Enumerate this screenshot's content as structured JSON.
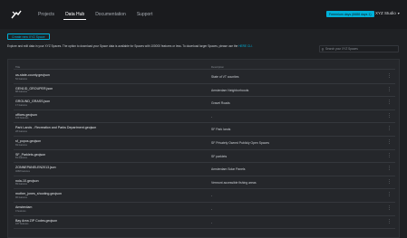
{
  "nav": {
    "items": [
      "Projects",
      "Data Hub",
      "Documentation",
      "Support"
    ],
    "active_index": 1
  },
  "header": {
    "badge": "Freemium days (6688 days 1)",
    "studio_label": "XYZ Studio"
  },
  "toolbar": {
    "create_label": "Create new XYZ Space"
  },
  "description": {
    "text": "Explore and edit data in your XYZ Spaces. The option to download your Space data is available for Spaces with 100000 features or less. To download larger Spaces, please use the ",
    "link": "HERE CLI."
  },
  "search": {
    "placeholder": "Search your XYZ Spaces"
  },
  "table": {
    "columns": [
      "Title",
      "Description"
    ],
    "rows": [
      {
        "name": "us-state-county.geojson",
        "meta": "52 features",
        "description": "State of VT counties"
      },
      {
        "name": "GEN1ID_GROUPER.json",
        "meta": "88 features",
        "description": "Amsterdam Neighborhoods"
      },
      {
        "name": "GROUND_GRASS.json",
        "meta": "17 features",
        "description": "Gravel Roads"
      },
      {
        "name": "offices.geojson",
        "meta": "120 features",
        "description": "-"
      },
      {
        "name": "Park Lands - Recreation and Parks Department.geojson",
        "meta": "28 features",
        "description": "SF Park lands"
      },
      {
        "name": "sf_popos.geojson",
        "meta": "69 features",
        "description": "SF Privately Owned Publicly Open Spaces"
      },
      {
        "name": "SF_Parklets.geojson",
        "meta": "81 features",
        "description": "SF parklets"
      },
      {
        "name": "ZONNEPANELEN2013.json",
        "meta": "4668 features",
        "description": "Amsterdam Solar Panels"
      },
      {
        "name": "nola-10.geojson",
        "meta": "89 features",
        "description": "Vermont accessible fishing areas"
      },
      {
        "name": "mother_jones_shooting.geojson",
        "meta": "96 features",
        "description": "-"
      },
      {
        "name": "Amsterdam",
        "meta": "0 features",
        "description": "-"
      },
      {
        "name": "Bay Area ZIP Codes.geojson",
        "meta": "187 features",
        "description": "-"
      }
    ]
  }
}
